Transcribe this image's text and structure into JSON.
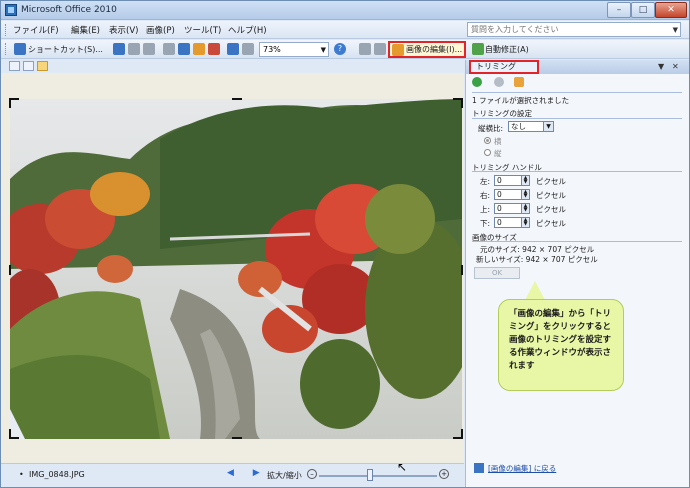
{
  "window": {
    "title": "Microsoft Office 2010",
    "minimize": "–",
    "maximize": "□",
    "close": "✕"
  },
  "menu": {
    "items": [
      "ファイル(F)",
      "編集(E)",
      "表示(V)",
      "画像(P)",
      "ツール(T)",
      "ヘルプ(H)"
    ],
    "help_placeholder": "質問を入力してください"
  },
  "toolbar": {
    "shortcut_label": "ショートカット(S)...",
    "zoom_value": "73%",
    "help_glyph": "?",
    "edit_image_label": "画像の編集(I)...",
    "autocorrect_label": "自動修正(A)"
  },
  "status": {
    "file_name": "IMG_0848.JPG",
    "bullet": "•",
    "prev_next": "◀ ▶",
    "zoom_label": "拡大/縮小",
    "zoom_minus": "–",
    "zoom_plus": "+"
  },
  "pane": {
    "title": "トリミング",
    "selected_info": "1 ファイルが選択されました",
    "trim_settings": "トリミングの設定",
    "aspect_label": "縦横比:",
    "aspect_value": "なし",
    "orientation_landscape": "横",
    "orientation_portrait": "縦",
    "handles_heading": "トリミング ハンドル",
    "handles": [
      {
        "label": "左:",
        "value": "0",
        "unit": "ピクセル"
      },
      {
        "label": "右:",
        "value": "0",
        "unit": "ピクセル"
      },
      {
        "label": "上:",
        "value": "0",
        "unit": "ピクセル"
      },
      {
        "label": "下:",
        "value": "0",
        "unit": "ピクセル"
      }
    ],
    "size_heading": "画像のサイズ",
    "original_size": "元のサイズ:  942 × 707 ピクセル",
    "new_size": "新しいサイズ:  942 × 707 ピクセル",
    "ok_label": "OK",
    "footer_link": "[画像の編集] に戻る"
  },
  "callout": {
    "text": "「画像の編集」から「トリミング」をクリックすると画像のトリミングを設定する作業ウィンドウが表示されます"
  },
  "colors": {
    "highlight_border": "#e0242a",
    "callout_bg": "#e8f7a6"
  }
}
